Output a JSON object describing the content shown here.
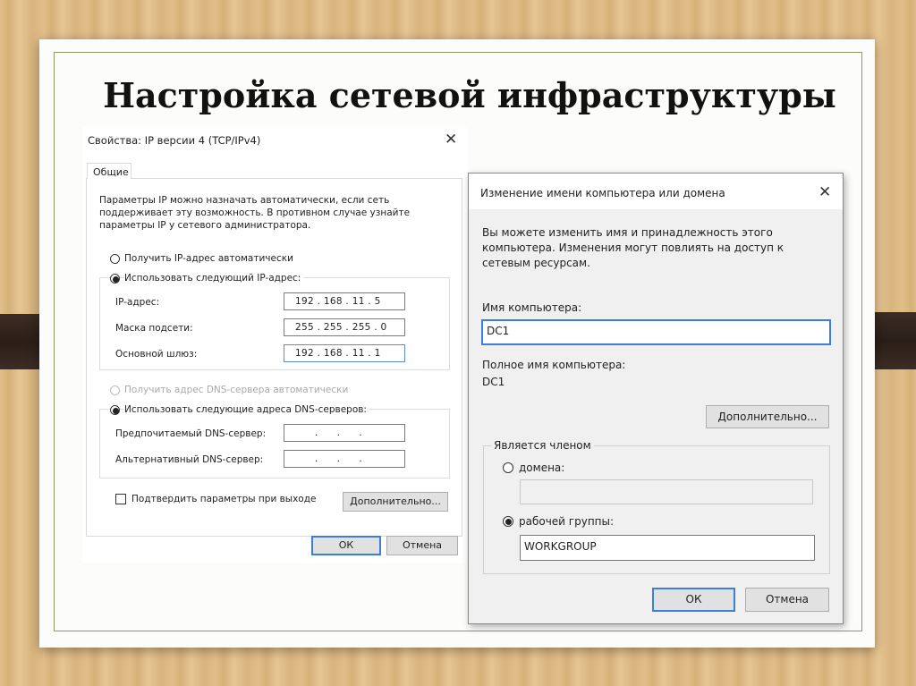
{
  "slide_title": "Настройка сетевой инфраструктуры",
  "ipv4_dialog": {
    "title": "Свойства: IP версии 4 (TCP/IPv4)",
    "tab": "Общие",
    "description": [
      "Параметры IP можно назначать автоматически, если сеть",
      "поддерживает эту возможность. В противном случае узнайте",
      "параметры IP у сетевого администратора."
    ],
    "radio_auto_ip": "Получить IP-адрес автоматически",
    "radio_manual_ip": "Использовать следующий IP-адрес:",
    "ip_label": "IP-адрес:",
    "ip_value": "192 . 168 . 11 . 5",
    "mask_label": "Маска подсети:",
    "mask_value": "255 . 255 . 255 . 0",
    "gateway_label": "Основной шлюз:",
    "gateway_value": "192 . 168 . 11 . 1",
    "radio_auto_dns": "Получить адрес DNS-сервера автоматически",
    "radio_manual_dns": "Использовать следующие адреса DNS-серверов:",
    "preferred_dns_label": "Предпочитаемый DNS-сервер:",
    "preferred_dns_value": ". . .",
    "alternate_dns_label": "Альтернативный DNS-сервер:",
    "alternate_dns_value": ". . .",
    "confirm_checkbox": "Подтвердить параметры при выходе",
    "advanced_button": "Дополнительно...",
    "ok_button": "ОК",
    "cancel_button": "Отмена"
  },
  "rename_dialog": {
    "title": "Изменение имени компьютера или домена",
    "description": [
      "Вы можете изменить имя и принадлежность этого",
      "компьютера. Изменения могут повлиять на доступ к",
      "сетевым ресурсам."
    ],
    "computer_name_label": "Имя компьютера:",
    "computer_name_value": "DC1",
    "full_name_label": "Полное имя компьютера:",
    "full_name_value": "DC1",
    "advanced_button": "Дополнительно...",
    "member_of_label": "Является членом",
    "domain_radio": "домена:",
    "domain_value": "",
    "workgroup_radio": "рабочей группы:",
    "workgroup_value": "WORKGROUP",
    "ok_button": "ОК",
    "cancel_button": "Отмена"
  }
}
